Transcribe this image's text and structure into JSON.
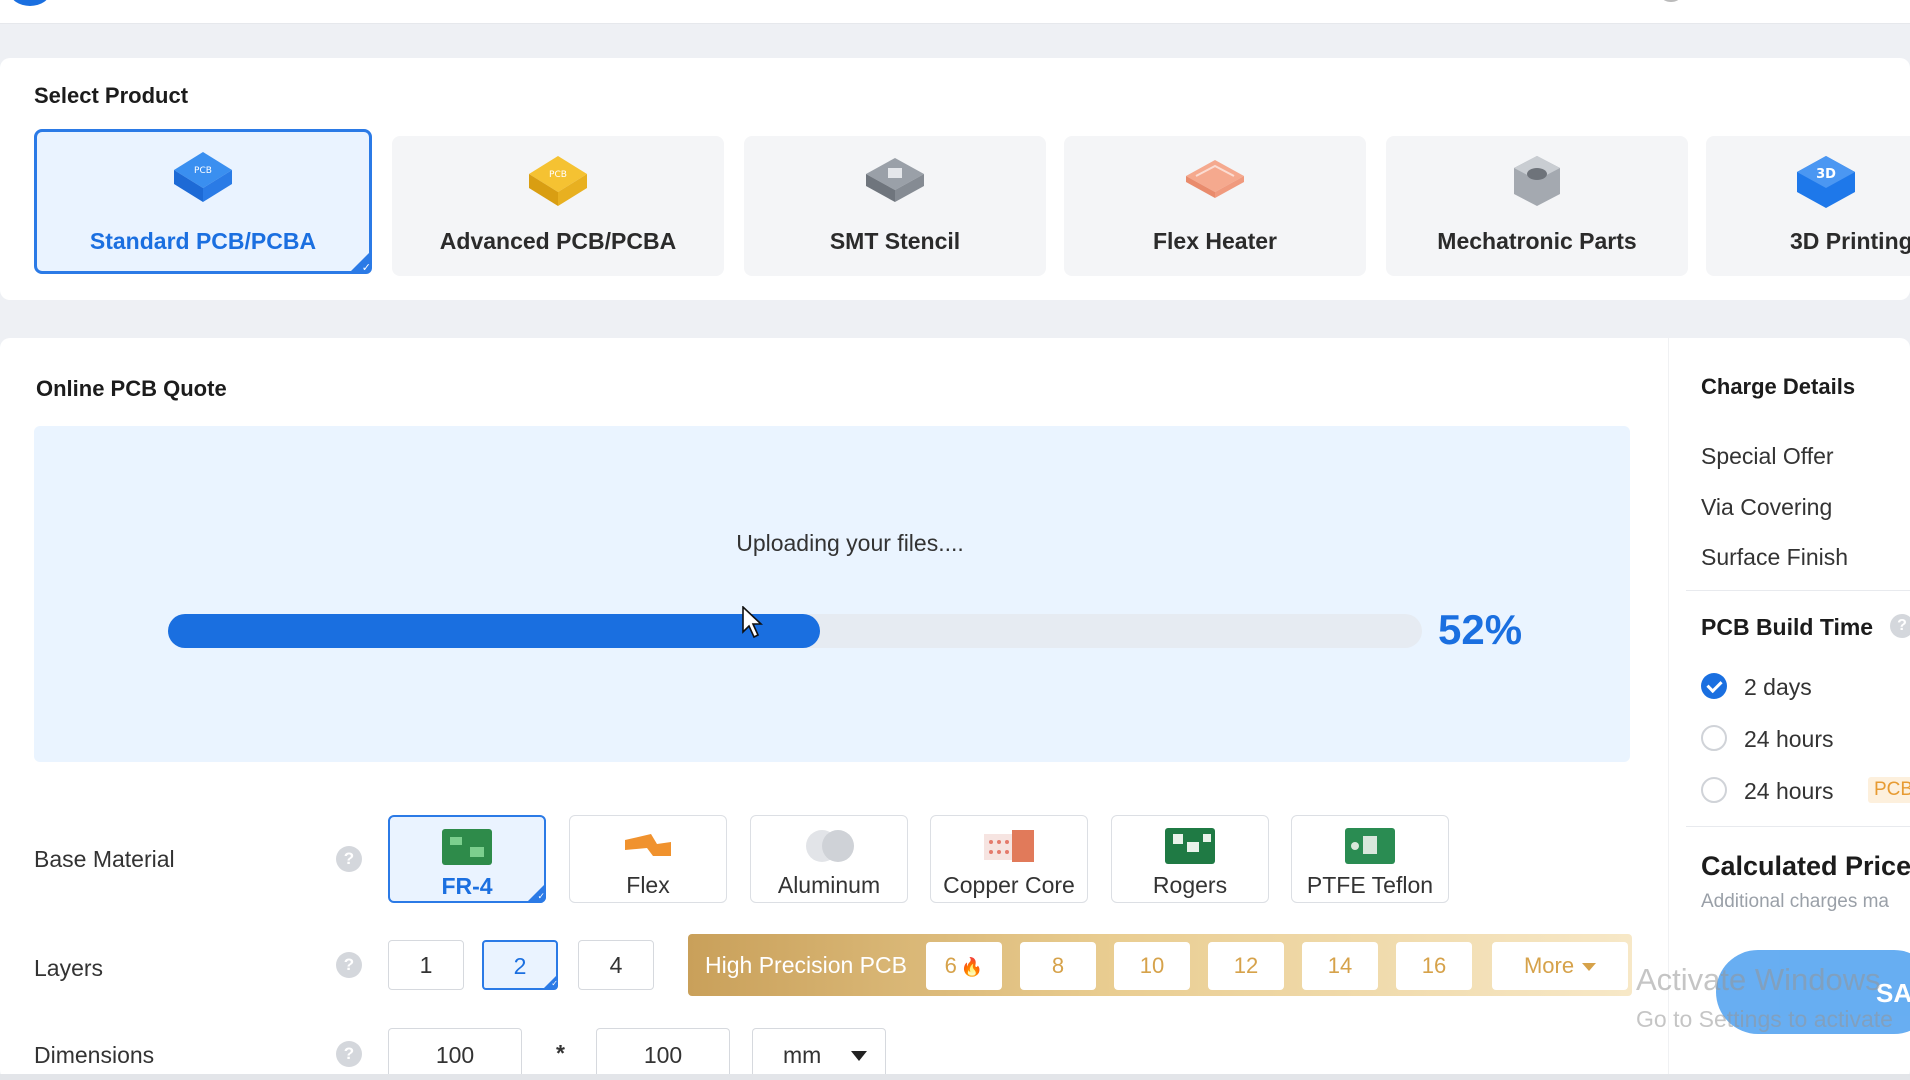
{
  "select_product": {
    "title": "Select Product",
    "items": [
      {
        "label": "Standard PCB/PCBA",
        "icon": "standard-pcb-icon",
        "active": true
      },
      {
        "label": "Advanced PCB/PCBA",
        "icon": "advanced-pcb-icon",
        "active": false
      },
      {
        "label": "SMT Stencil",
        "icon": "smt-stencil-icon",
        "active": false
      },
      {
        "label": "Flex Heater",
        "icon": "flex-heater-icon",
        "active": false
      },
      {
        "label": "Mechatronic Parts",
        "icon": "mechatronic-parts-icon",
        "active": false
      },
      {
        "label": "3D Printing",
        "icon": "3d-printing-icon",
        "active": false
      }
    ]
  },
  "quote": {
    "title": "Online PCB Quote",
    "upload": {
      "message": "Uploading your files....",
      "progress_percent": 52,
      "progress_label": "52%"
    },
    "base_material": {
      "label": "Base Material",
      "options": [
        "FR-4",
        "Flex",
        "Aluminum",
        "Copper Core",
        "Rogers",
        "PTFE Teflon"
      ],
      "selected": "FR-4"
    },
    "layers": {
      "label": "Layers",
      "options": [
        "1",
        "2",
        "4"
      ],
      "selected": "2",
      "high_precision": {
        "title": "High Precision PCB",
        "options": [
          "6",
          "8",
          "10",
          "12",
          "14",
          "16"
        ],
        "more_label": "More"
      }
    },
    "dimensions": {
      "label": "Dimensions",
      "width": "100",
      "times": "*",
      "height": "100",
      "unit": "mm"
    }
  },
  "charge_details": {
    "title": "Charge Details",
    "items": [
      "Special Offer",
      "Via Covering",
      "Surface Finish"
    ],
    "build_time": {
      "title": "PCB Build Time",
      "options": [
        {
          "label": "2 days",
          "checked": true
        },
        {
          "label": "24 hours",
          "checked": false
        },
        {
          "label": "24 hours",
          "checked": false
        }
      ],
      "tag": "PCB"
    },
    "calculated_price": "Calculated Price",
    "additional_note": "Additional charges ma"
  },
  "save_button_label": "SA",
  "watermark": {
    "title": "Activate Windows",
    "subtitle": "Go to Settings to activate"
  },
  "colors": {
    "accent": "#1a6fe0",
    "upload_bg": "#eaf4ff",
    "high_precision_gold": "#d6a24a"
  }
}
